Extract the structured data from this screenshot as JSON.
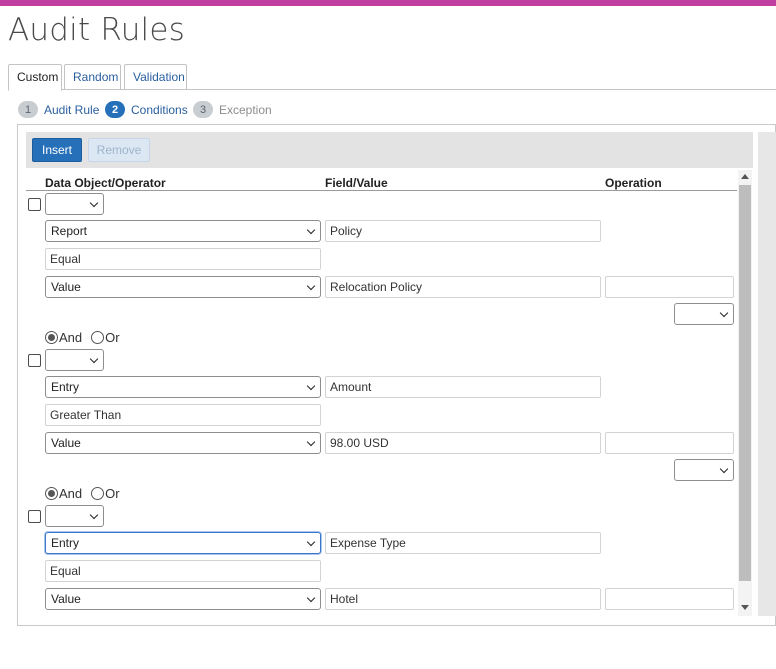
{
  "page": {
    "title": "Audit Rules",
    "accent_color": "#c03ea0",
    "primary_color": "#2670b9"
  },
  "tabs": [
    {
      "label": "Custom",
      "active": true
    },
    {
      "label": "Random",
      "active": false
    },
    {
      "label": "Validation",
      "active": false
    }
  ],
  "wizard": [
    {
      "num": "1",
      "label": "Audit Rule",
      "state": "done"
    },
    {
      "num": "2",
      "label": "Conditions",
      "state": "active"
    },
    {
      "num": "3",
      "label": "Exception",
      "state": "disabled"
    }
  ],
  "toolbar": {
    "insert_label": "Insert",
    "remove_label": "Remove"
  },
  "grid": {
    "headers": {
      "object": "Data Object/Operator",
      "field": "Field/Value",
      "operation": "Operation"
    }
  },
  "conditions": [
    {
      "object": "Report",
      "field": "Policy",
      "operator": "Equal",
      "value_type": "Value",
      "value": "Relocation Policy",
      "operation": ""
    },
    {
      "object": "Entry",
      "field": "Amount",
      "operator": "Greater Than",
      "value_type": "Value",
      "value": "98.00 USD",
      "operation": ""
    },
    {
      "object": "Entry",
      "field": "Expense Type",
      "operator": "Equal",
      "value_type": "Value",
      "value": "Hotel",
      "operation": ""
    }
  ],
  "connectors": [
    {
      "and_label": "And",
      "or_label": "Or",
      "selected": "And"
    },
    {
      "and_label": "And",
      "or_label": "Or",
      "selected": "And"
    }
  ]
}
